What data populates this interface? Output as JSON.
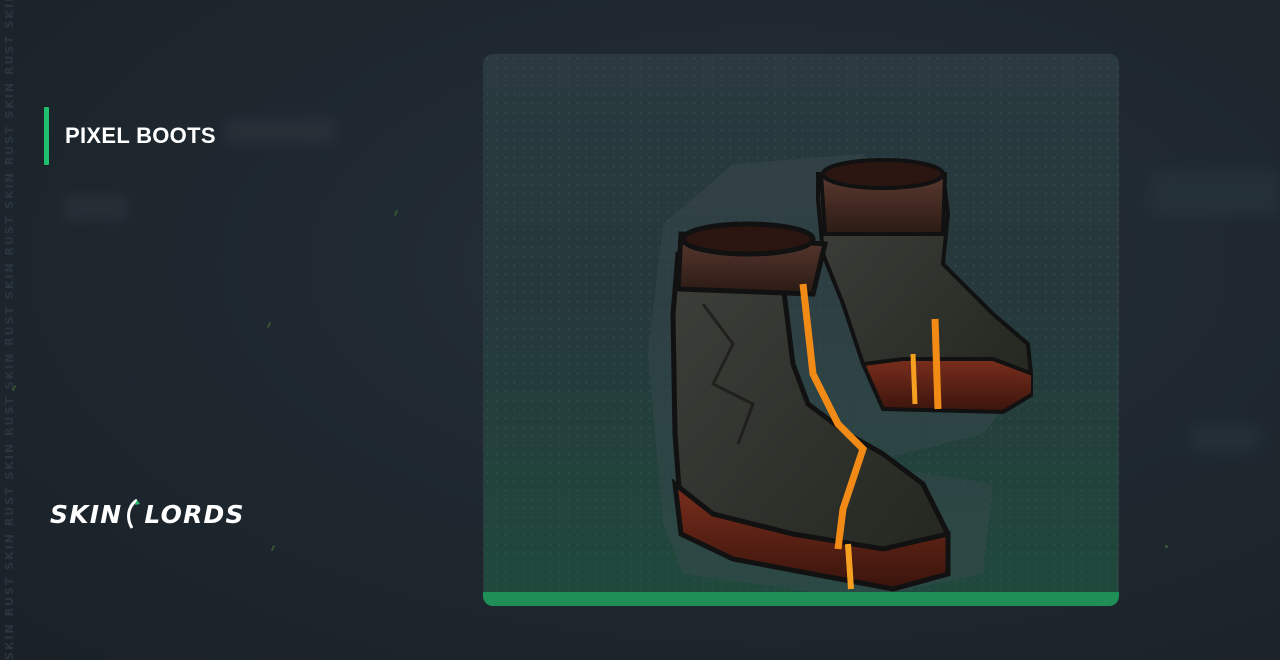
{
  "item": {
    "name": "PIXEL BOOTS",
    "image_icon": "pixel-boots-image"
  },
  "brand": {
    "logo_left": "SKIN",
    "logo_right": "LORDS"
  },
  "watermark": {
    "text": "SKIN RUST SKIN RUST SKIN RUST SKIN RUST SKIN RUST SKIN RUST SKIN RUST SKIN RUST SKIN RUST SKIN RUST SKIN RUST SKIN"
  },
  "colors": {
    "accent": "#1fbf6e",
    "card_bottom": "#1f8f57",
    "background": "#1f2830"
  }
}
